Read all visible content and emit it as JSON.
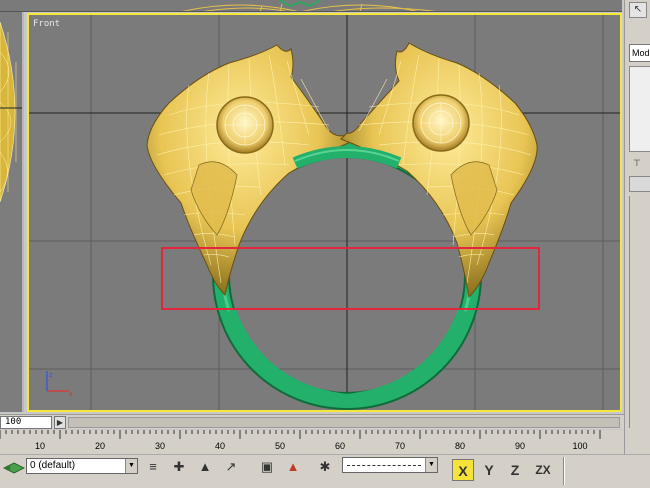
{
  "viewport": {
    "label": "Front",
    "active_border_color": "#f5e83a",
    "background_color": "#7b7b7b",
    "gizmo_axes": {
      "x": "x",
      "z": "z"
    }
  },
  "model": {
    "ring_color": "#22b06a",
    "head_color": "#f0d060",
    "wire_color": "#fff4b0",
    "selection_region_color": "#e3263c"
  },
  "command_panel": {
    "tab_label": "Mod",
    "pin_icon": "pin-icon",
    "tool_icon": "select-cursor-icon"
  },
  "time_slider": {
    "current_frame": "100",
    "next_icon": "triangle-right-icon"
  },
  "ruler": {
    "ticks": [
      "10",
      "20",
      "30",
      "40",
      "50",
      "60",
      "70",
      "80",
      "90",
      "100"
    ]
  },
  "toolbar": {
    "layer_name": "0 (default)",
    "icons": [
      "layers-icon",
      "stack-icon",
      "create-icon",
      "select-link-icon",
      "unlink-icon",
      "bind-space-warp-icon",
      "named-selection-icon",
      "schematic-icon"
    ],
    "axis_buttons": {
      "x": "X",
      "y": "Y",
      "z": "Z",
      "zx": "ZX"
    },
    "active_axis_color": "#f6e33a"
  }
}
